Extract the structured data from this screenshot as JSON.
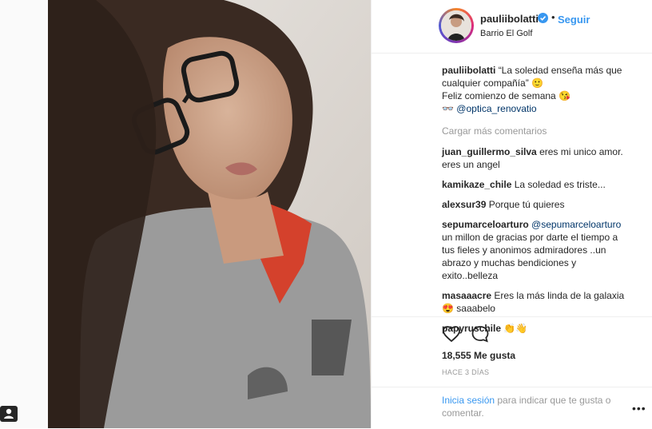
{
  "post": {
    "username": "pauliibolatti",
    "follow_label": "Seguir",
    "separator": "•",
    "location": "Barrio El Golf"
  },
  "caption": {
    "username": "pauliibolatti",
    "line1": "“La soledad enseña más que cualquier compañía” 🙂",
    "line2": "Feliz comienzo de semana 😘",
    "glasses_emoji": "👓",
    "mention": "@optica_renovatio"
  },
  "load_more": "Cargar más comentarios",
  "comments": [
    {
      "user": "juan_guillermo_silva",
      "text": "eres mi unico amor. eres un angel"
    },
    {
      "user": "kamikaze_chile",
      "text": "La soledad es triste..."
    },
    {
      "user": "alexsur39",
      "text": "Porque tú quieres"
    },
    {
      "user": "sepumarceloarturo",
      "mention": "@sepumarceloarturo",
      "text": "un millon de gracias por darte el tiempo a tus fieles y anonimos admiradores ..un abrazo y muchas bendiciones y exito..belleza"
    },
    {
      "user": "masaaacre",
      "text": "Eres la más linda de la galaxia 😍 saaabelo"
    },
    {
      "user": "papyruschile",
      "text": "👏👋"
    }
  ],
  "likes": "18,555 Me gusta",
  "time": "HACE 3 DÍAS",
  "footer": {
    "login_link": "Inicia sesión",
    "login_text": " para indicar que te gusta o comentar."
  },
  "more_label": "•••",
  "icons": {
    "verified": "verified-badge-icon",
    "like": "heart-icon",
    "comment": "speech-bubble-icon",
    "more": "more-options-icon"
  },
  "colors": {
    "link": "#3897f0",
    "mention": "#003569",
    "muted": "#999999",
    "text": "#262626"
  }
}
